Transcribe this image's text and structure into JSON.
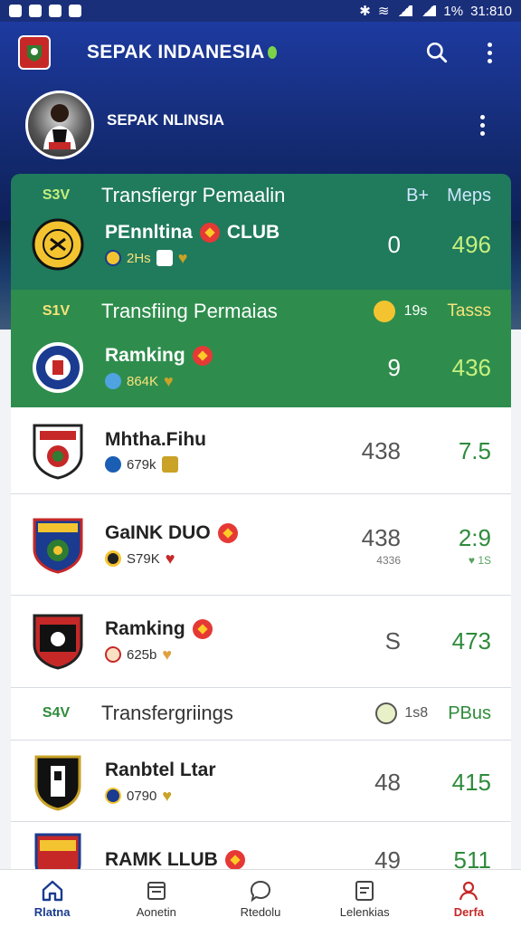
{
  "status_bar": {
    "time": "31:810",
    "battery": "1%"
  },
  "app": {
    "title": "SEPAK INDANESIA",
    "colors": {
      "header": "#173081",
      "accent_green": "#2e8d4d",
      "highlight": "#c5f07d"
    }
  },
  "profile": {
    "name": "SEPAK NLINSIA"
  },
  "sections": [
    {
      "code": "S3V",
      "title": "Transfiergr Pemaalin",
      "right1": "B+",
      "right2": "Meps"
    },
    {
      "code": "S1V",
      "title": "Transfiing Permaias",
      "right1": "19s",
      "right2": "Tasss"
    },
    {
      "code": "S4V",
      "title": "Transfergriings",
      "right1": "1s8",
      "right2": "PBus"
    }
  ],
  "clubs": [
    {
      "name": "PEnnltina",
      "suffix": "CLUB",
      "sub": "2Hs",
      "stat_left": "0",
      "stat_right": "496"
    },
    {
      "name": "Ramking",
      "sub": "864K",
      "stat_left": "9",
      "stat_right": "436"
    },
    {
      "name": "Mhtha.Fihu",
      "sub": "679k",
      "stat_left": "438",
      "stat_right": "7.5"
    },
    {
      "name": "GaINK DUO",
      "sub": "S79K",
      "stat_left": "438",
      "stat_left_small": "4336",
      "stat_right": "2:9",
      "stat_right_small": "♥ 1S"
    },
    {
      "name": "Ramking",
      "sub": "625b",
      "stat_left": "S",
      "stat_right": "473"
    },
    {
      "name": "Ranbtel Ltar",
      "sub": "0790",
      "stat_left": "48",
      "stat_right": "415"
    },
    {
      "name": "RAMK LLUB",
      "sub": "",
      "stat_left": "49",
      "stat_right": "511"
    }
  ],
  "nav": [
    {
      "label": "Rlatna",
      "icon": "home-icon"
    },
    {
      "label": "Aonetin",
      "icon": "calendar-icon"
    },
    {
      "label": "Rtedolu",
      "icon": "chat-icon"
    },
    {
      "label": "Lelenkias",
      "icon": "list-icon"
    },
    {
      "label": "Derfa",
      "icon": "profile-icon"
    }
  ]
}
